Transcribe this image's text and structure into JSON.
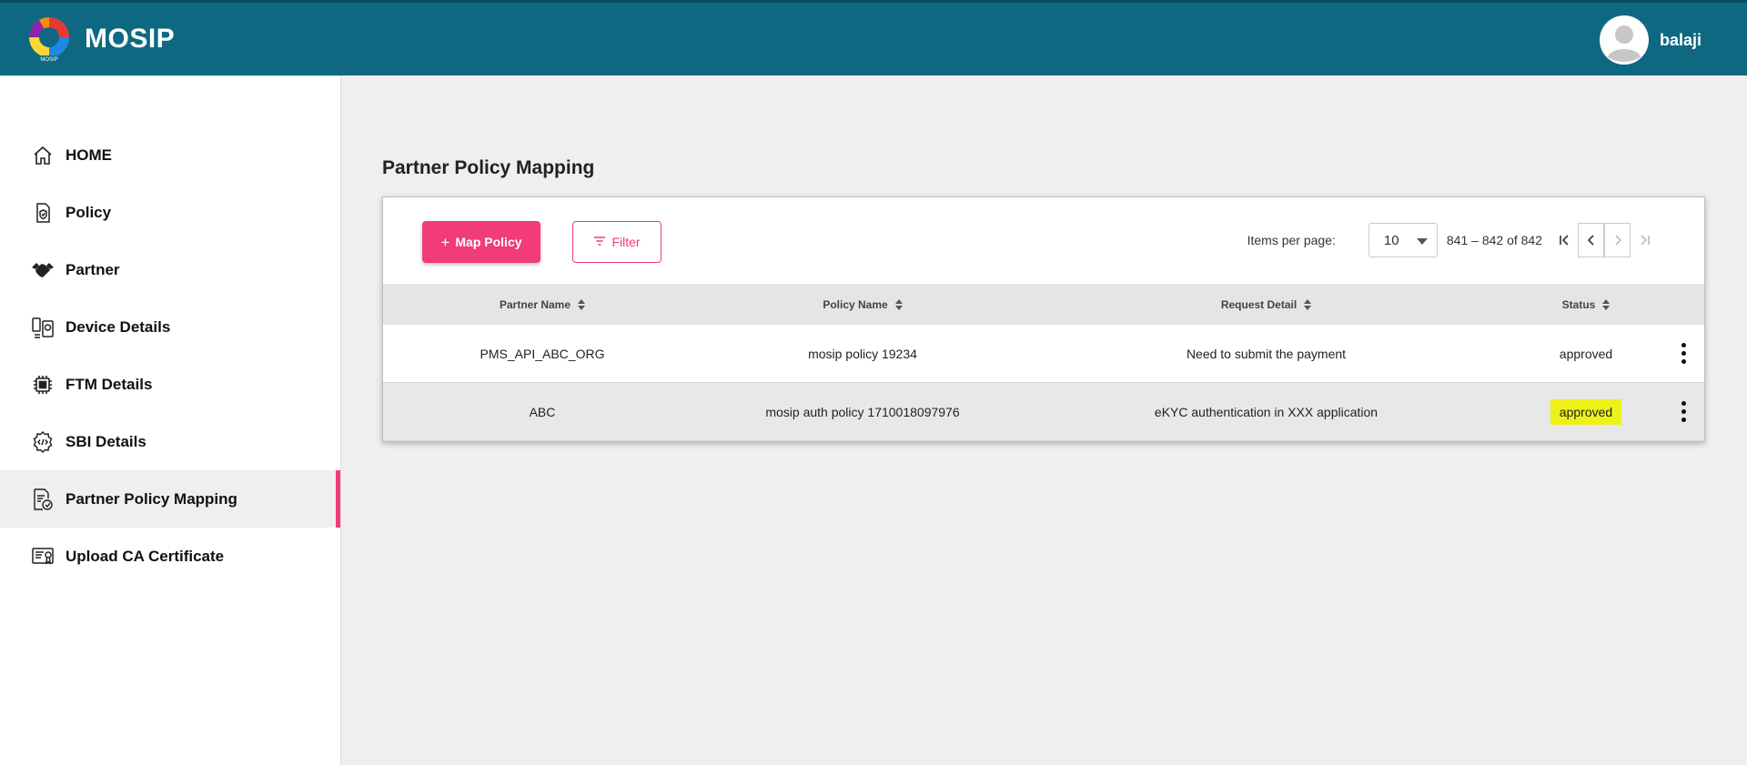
{
  "header": {
    "brand": "MOSIP",
    "user_name": "balaji",
    "colors": {
      "bar": "#0e6882",
      "accent": "#f13c78"
    }
  },
  "sidebar": {
    "items": [
      {
        "label": "HOME",
        "icon": "home-icon"
      },
      {
        "label": "Policy",
        "icon": "policy-shield-icon"
      },
      {
        "label": "Partner",
        "icon": "handshake-icon"
      },
      {
        "label": "Device Details",
        "icon": "device-icon"
      },
      {
        "label": "FTM Details",
        "icon": "chip-icon"
      },
      {
        "label": "SBI Details",
        "icon": "code-gear-icon"
      },
      {
        "label": "Partner Policy Mapping",
        "icon": "document-link-icon",
        "active": true
      },
      {
        "label": "Upload CA Certificate",
        "icon": "certificate-icon"
      }
    ]
  },
  "main": {
    "title": "Partner Policy Mapping",
    "map_policy_label": "Map Policy",
    "filter_label": "Filter",
    "pager": {
      "items_per_page_label": "Items per page:",
      "items_per_page": "10",
      "range": "841 – 842 of 842"
    },
    "columns": [
      "Partner Name",
      "Policy Name",
      "Request Detail",
      "Status"
    ],
    "rows": [
      {
        "partner": "PMS_API_ABC_ORG",
        "policy": "mosip policy 19234",
        "request": "Need to submit the payment",
        "status": "approved",
        "highlighted": false
      },
      {
        "partner": "ABC",
        "policy": "mosip auth policy 1710018097976",
        "request": "eKYC authentication in XXX application",
        "status": "approved",
        "highlighted": true
      }
    ]
  }
}
